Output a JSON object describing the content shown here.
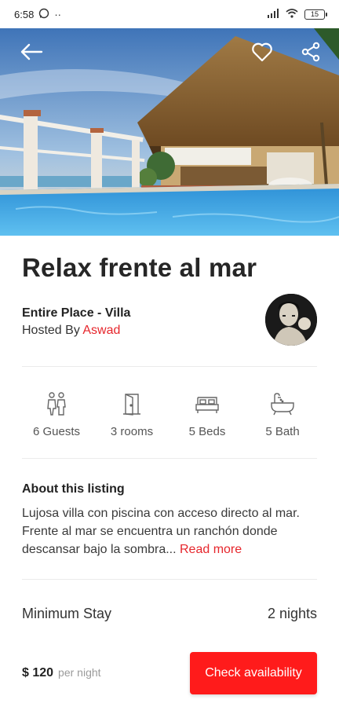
{
  "status_bar": {
    "time": "6:58",
    "more": "··",
    "battery": "15"
  },
  "hero": {
    "back_icon": "arrow-left-icon",
    "favorite_icon": "heart-icon",
    "share_icon": "share-icon"
  },
  "listing": {
    "title": "Relax frente al mar",
    "place_type": "Entire Place - Villa",
    "hosted_by_prefix": "Hosted By",
    "host_name": "Aswad"
  },
  "amenities": [
    {
      "icon": "guests-icon",
      "label": "6 Guests"
    },
    {
      "icon": "door-icon",
      "label": "3 rooms"
    },
    {
      "icon": "bed-icon",
      "label": "5 Beds"
    },
    {
      "icon": "bathtub-icon",
      "label": "5 Bath"
    }
  ],
  "about": {
    "title": "About this listing",
    "text": "Lujosa villa con piscina con acceso directo al mar. Frente al mar se encuentra un ranchón donde descansar bajo la sombra...",
    "read_more": "Read more"
  },
  "stay": {
    "label": "Minimum Stay",
    "value": "2 nights"
  },
  "booking": {
    "price": "$ 120",
    "per": "per night",
    "cta": "Check availability"
  },
  "colors": {
    "accent": "#e6262c",
    "cta_background": "#ff1b1b"
  }
}
